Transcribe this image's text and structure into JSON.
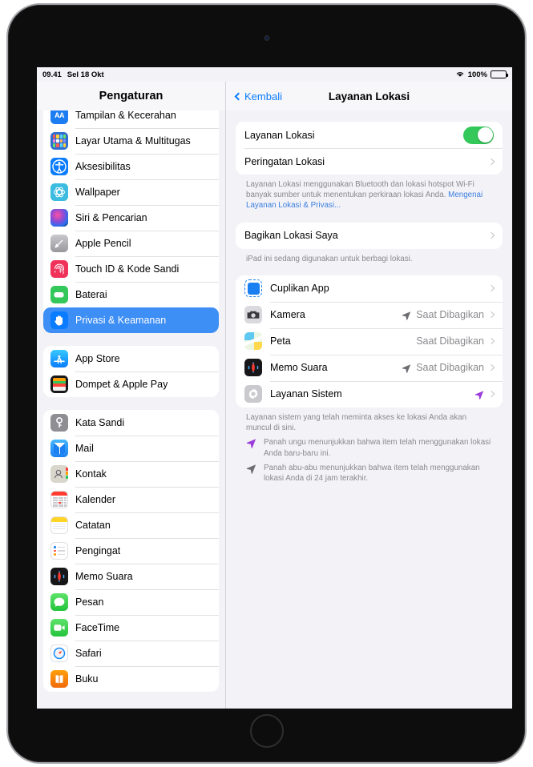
{
  "status_bar": {
    "time": "09.41",
    "date": "Sel 18 Okt",
    "wifi_icon": "wifi-icon",
    "battery_percent": "100%",
    "battery_icon": "battery-full-icon"
  },
  "sidebar": {
    "title": "Pengaturan",
    "groups": [
      {
        "items": [
          {
            "label": "Tampilan & Kecerahan",
            "icon": "display-brightness-icon",
            "selected": false
          },
          {
            "label": "Layar Utama & Multitugas",
            "icon": "home-screen-multitasking-icon",
            "selected": false
          },
          {
            "label": "Aksesibilitas",
            "icon": "accessibility-icon",
            "selected": false
          },
          {
            "label": "Wallpaper",
            "icon": "wallpaper-icon",
            "selected": false
          },
          {
            "label": "Siri & Pencarian",
            "icon": "siri-search-icon",
            "selected": false
          },
          {
            "label": "Apple Pencil",
            "icon": "apple-pencil-icon",
            "selected": false
          },
          {
            "label": "Touch ID & Kode Sandi",
            "icon": "touch-id-icon",
            "selected": false
          },
          {
            "label": "Baterai",
            "icon": "battery-icon",
            "selected": false
          },
          {
            "label": "Privasi & Keamanan",
            "icon": "privacy-hand-icon",
            "selected": true
          }
        ]
      },
      {
        "items": [
          {
            "label": "App Store",
            "icon": "app-store-icon",
            "selected": false
          },
          {
            "label": "Dompet & Apple Pay",
            "icon": "wallet-icon",
            "selected": false
          }
        ]
      },
      {
        "items": [
          {
            "label": "Kata Sandi",
            "icon": "passwords-key-icon",
            "selected": false
          },
          {
            "label": "Mail",
            "icon": "mail-icon",
            "selected": false
          },
          {
            "label": "Kontak",
            "icon": "contacts-icon",
            "selected": false
          },
          {
            "label": "Kalender",
            "icon": "calendar-icon",
            "selected": false
          },
          {
            "label": "Catatan",
            "icon": "notes-icon",
            "selected": false
          },
          {
            "label": "Pengingat",
            "icon": "reminders-icon",
            "selected": false
          },
          {
            "label": "Memo Suara",
            "icon": "voice-memos-icon",
            "selected": false
          },
          {
            "label": "Pesan",
            "icon": "messages-icon",
            "selected": false
          },
          {
            "label": "FaceTime",
            "icon": "facetime-icon",
            "selected": false
          },
          {
            "label": "Safari",
            "icon": "safari-icon",
            "selected": false
          },
          {
            "label": "Buku",
            "icon": "books-icon",
            "selected": false
          }
        ]
      }
    ]
  },
  "detail": {
    "back_label": "Kembali",
    "back_icon": "chevron-left-icon",
    "title": "Layanan Lokasi",
    "group_main": {
      "toggle_row": {
        "label": "Layanan Lokasi",
        "toggle_on": true,
        "toggle_color": "#34c759"
      },
      "alerts_row": {
        "label": "Peringatan Lokasi",
        "chevron_icon": "chevron-right-icon"
      },
      "footnote_text": "Layanan Lokasi menggunakan Bluetooth dan lokasi hotspot Wi-Fi banyak sumber untuk menentukan perkiraan lokasi Anda. ",
      "footnote_link": "Mengenai Layanan Lokasi & Privasi..."
    },
    "group_share": {
      "row_label": "Bagikan Lokasi Saya",
      "chevron_icon": "chevron-right-icon",
      "footnote_text": "iPad ini sedang digunakan untuk berbagi lokasi."
    },
    "apps": [
      {
        "label": "Cuplikan App",
        "icon": "app-clips-icon",
        "value": "",
        "arrow": "none"
      },
      {
        "label": "Kamera",
        "icon": "camera-icon",
        "value": "Saat Dibagikan",
        "arrow": "gray"
      },
      {
        "label": "Peta",
        "icon": "maps-icon",
        "value": "Saat Dibagikan",
        "arrow": "none"
      },
      {
        "label": "Memo Suara",
        "icon": "voice-memos-icon",
        "value": "Saat Dibagikan",
        "arrow": "gray"
      },
      {
        "label": "Layanan Sistem",
        "icon": "system-services-gear-icon",
        "value": "",
        "arrow": "purple"
      }
    ],
    "apps_footnote": "Layanan sistem yang telah meminta akses ke lokasi Anda akan muncul di sini.",
    "legend": [
      {
        "arrow": "purple",
        "text": "Panah ungu menunjukkan bahwa item telah menggunakan lokasi Anda baru-baru ini."
      },
      {
        "arrow": "gray",
        "text": "Panah abu-abu menunjukkan bahwa item telah menggunakan lokasi Anda di 24 jam terakhir."
      }
    ]
  },
  "colors": {
    "accent_blue": "#0a7cff",
    "selected_row": "#3d8ef5",
    "toggle_green": "#34c759",
    "arrow_purple": "#9b3ddb",
    "arrow_gray": "#6d6d72",
    "secondary_text": "#8a8a8e"
  }
}
